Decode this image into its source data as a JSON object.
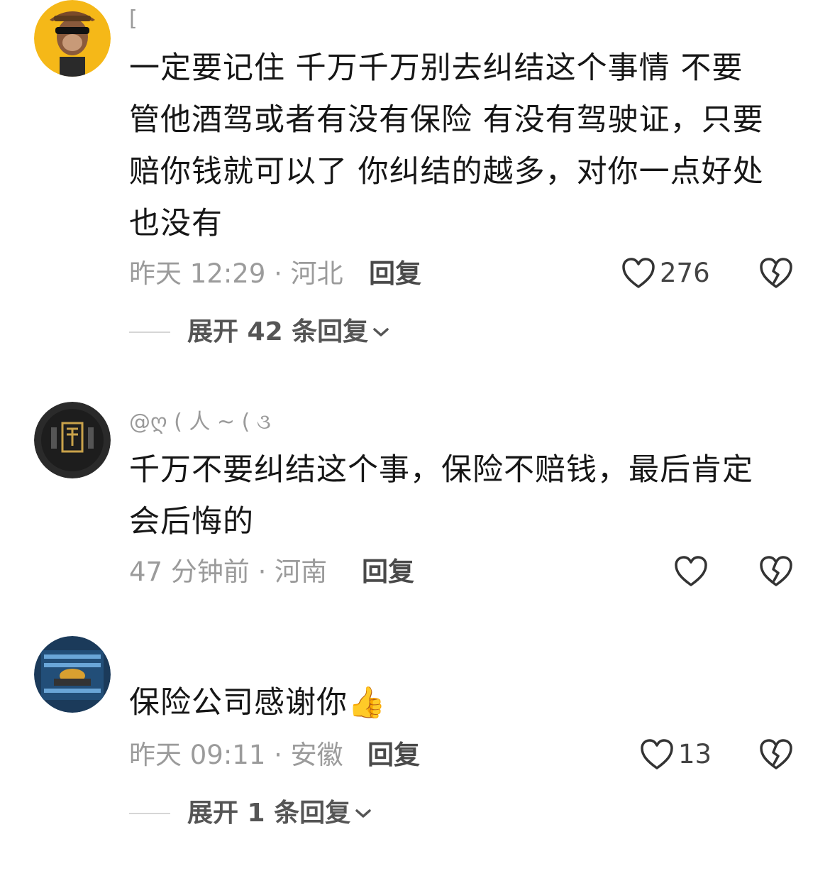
{
  "comments": [
    {
      "username": "[",
      "lines": [
        "一定要记住  千万千万别去纠结这个事情  不要",
        "管他酒驾或者有没有保险 有没有驾驶证，只要",
        "赔你钱就可以了  你纠结的越多，对你一点好处",
        "也没有"
      ],
      "time_location": "昨天 12:29 · 河北",
      "reply_label": "回复",
      "like_count": "276",
      "expand_label": "展开 42 条回复"
    },
    {
      "username": "@ღ  ( 人  ~ ( ૩",
      "lines": [
        "千万不要纠结这个事，保险不赔钱，最后肯定",
        "会后悔的"
      ],
      "time_location": "47 分钟前 · 河南",
      "reply_label": "回复",
      "like_count": ""
    },
    {
      "username": "",
      "lines": [
        "保险公司感谢你"
      ],
      "emoji": "👍",
      "time_location": "昨天 09:11 · 安徽",
      "reply_label": "回复",
      "like_count": "13",
      "expand_label": "展开 1 条回复"
    }
  ],
  "icons": {
    "like": "heart-outline-icon",
    "dislike": "broken-heart-icon",
    "expand": "chevron-down-icon"
  },
  "colors": {
    "text": "#161616",
    "meta": "#9b9b9b",
    "reply": "#4a4a4a"
  }
}
